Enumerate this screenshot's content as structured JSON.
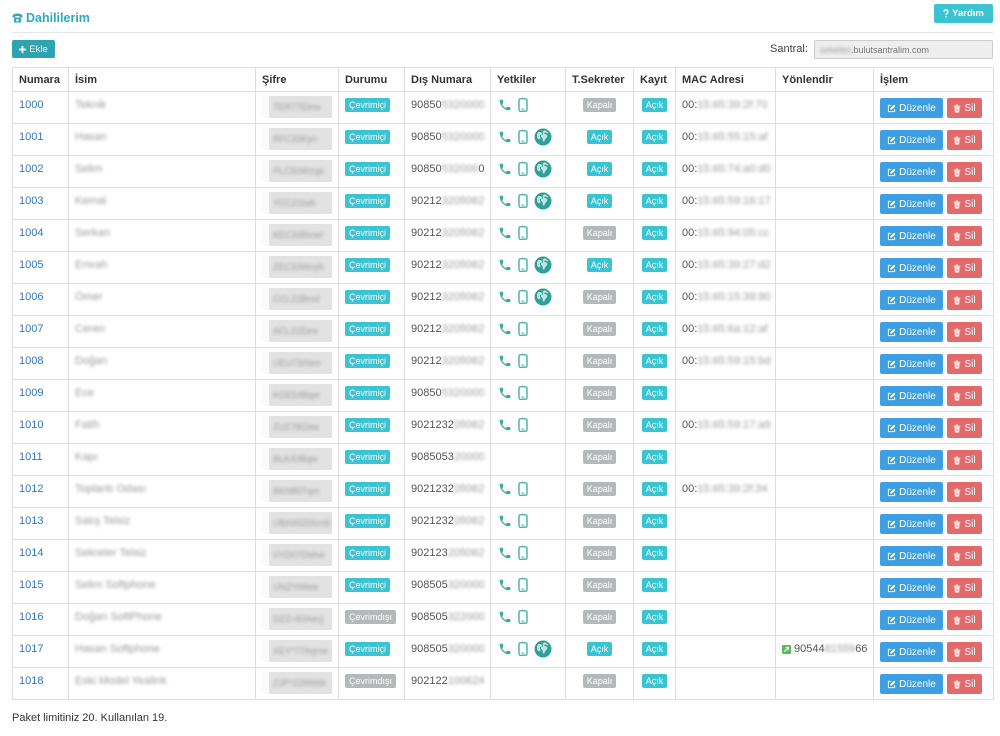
{
  "header": {
    "title": "Dahililerim",
    "help_label": "Yardım"
  },
  "toolbar": {
    "add_label": "Ekle",
    "santral_label": "Santral:",
    "santral_value_masked": "sirketim",
    "santral_value": ".bulutsantralim.com"
  },
  "table": {
    "columns": [
      "Numara",
      "İsim",
      "Şifre",
      "Durumu",
      "Dış Numara",
      "Yetkiler",
      "T.Sekreter",
      "Kayıt",
      "MAC Adresi",
      "Yönlendir",
      "İşlem"
    ],
    "edit_label": "Düzenle",
    "delete_label": "Sil",
    "rows": [
      {
        "number": "1000",
        "name": "Teknik",
        "password": "TER77Elmx",
        "status": "Çevrimiçi",
        "online": true,
        "ext_prefix": "90850",
        "ext_masked": "5320000",
        "perms": [
          "phone-icon",
          "mobile-icon"
        ],
        "secretary": "Kapalı",
        "secretary_on": false,
        "record": "Açık",
        "record_on": true,
        "mac_prefix": "00:",
        "mac_masked": "15:65:39:2f:70"
      },
      {
        "number": "1001",
        "name": "Hasan",
        "password": "RFC33Kyn",
        "status": "Çevrimiçi",
        "online": true,
        "ext_prefix": "90850",
        "ext_masked": "5320000",
        "perms": [
          "phone-icon",
          "mobile-icon",
          "globe-icon"
        ],
        "secretary": "Açık",
        "secretary_on": true,
        "record": "Açık",
        "record_on": true,
        "mac_prefix": "00:",
        "mac_masked": "15:65:55:15:af"
      },
      {
        "number": "1002",
        "name": "Selim",
        "password": "PLC50Wzqa",
        "status": "Çevrimiçi",
        "online": true,
        "ext_prefix": "90850",
        "ext_masked": "532000",
        "ext_suffix": "0",
        "perms": [
          "phone-icon",
          "mobile-icon",
          "globe-icon"
        ],
        "secretary": "Açık",
        "secretary_on": true,
        "record": "Açık",
        "record_on": true,
        "mac_prefix": "00:",
        "mac_masked": "15:65:74:a0:d0"
      },
      {
        "number": "1003",
        "name": "Kemal",
        "password": "YCC21lwb",
        "status": "Çevrimiçi",
        "online": true,
        "ext_prefix": "90212",
        "ext_masked": "3205062",
        "perms": [
          "phone-icon",
          "mobile-icon",
          "globe-icon"
        ],
        "secretary": "Açık",
        "secretary_on": true,
        "record": "Açık",
        "record_on": true,
        "mac_prefix": "00:",
        "mac_masked": "15:65:59:16:17"
      },
      {
        "number": "1004",
        "name": "Serkan",
        "password": "KEC33Rmer",
        "status": "Çevrimiçi",
        "online": true,
        "ext_prefix": "90212",
        "ext_masked": "3205062",
        "perms": [
          "phone-icon",
          "mobile-icon"
        ],
        "secretary": "Kapalı",
        "secretary_on": false,
        "record": "Açık",
        "record_on": true,
        "mac_prefix": "00:",
        "mac_masked": "15:65:94:05:cc"
      },
      {
        "number": "1005",
        "name": "Emrah",
        "password": "ZEC33Wnyh",
        "status": "Çevrimiçi",
        "online": true,
        "ext_prefix": "90212",
        "ext_masked": "3205062",
        "perms": [
          "phone-icon",
          "mobile-icon",
          "globe-icon"
        ],
        "secretary": "Açık",
        "secretary_on": true,
        "record": "Açık",
        "record_on": true,
        "mac_prefix": "00:",
        "mac_masked": "15:65:39:27:d2"
      },
      {
        "number": "1006",
        "name": "Ömer",
        "password": "CCL22Bmd",
        "status": "Çevrimiçi",
        "online": true,
        "ext_prefix": "90212",
        "ext_masked": "3205062",
        "perms": [
          "phone-icon",
          "mobile-icon",
          "globe-icon"
        ],
        "secretary": "Kapalı",
        "secretary_on": false,
        "record": "Açık",
        "record_on": true,
        "mac_prefix": "00:",
        "mac_masked": "15:65:15:39:80"
      },
      {
        "number": "1007",
        "name": "Ceren",
        "password": "ACL22Eew",
        "status": "Çevrimiçi",
        "online": true,
        "ext_prefix": "90212",
        "ext_masked": "3205062",
        "perms": [
          "phone-icon",
          "mobile-icon"
        ],
        "secretary": "Kapalı",
        "secretary_on": false,
        "record": "Açık",
        "record_on": true,
        "mac_prefix": "00:",
        "mac_masked": "15:65:6a:12:af"
      },
      {
        "number": "1008",
        "name": "Doğan",
        "password": "UEU73Xbm",
        "status": "Çevrimiçi",
        "online": true,
        "ext_prefix": "90212",
        "ext_masked": "3205062",
        "perms": [
          "phone-icon",
          "mobile-icon"
        ],
        "secretary": "Kapalı",
        "secretary_on": false,
        "record": "Açık",
        "record_on": true,
        "mac_prefix": "00:",
        "mac_masked": "15:65:59:15:bd"
      },
      {
        "number": "1009",
        "name": "Ece",
        "password": "KGE54Bqw",
        "status": "Çevrimiçi",
        "online": true,
        "ext_prefix": "90850",
        "ext_masked": "5320000",
        "perms": [
          "phone-icon",
          "mobile-icon"
        ],
        "secretary": "Kapalı",
        "secretary_on": false,
        "record": "Açık",
        "record_on": true
      },
      {
        "number": "1010",
        "name": "Fatih",
        "password": "ZUZ78Gbw",
        "status": "Çevrimiçi",
        "online": true,
        "ext_prefix": "9021232",
        "ext_masked": "05062",
        "perms": [
          "phone-icon",
          "mobile-icon"
        ],
        "secretary": "Kapalı",
        "secretary_on": false,
        "record": "Açık",
        "record_on": true,
        "mac_prefix": "00:",
        "mac_masked": "15:65:59:17:a9"
      },
      {
        "number": "1011",
        "name": "Kapı",
        "password": "BLK43Bqw",
        "status": "Çevrimiçi",
        "online": true,
        "ext_prefix": "9085053",
        "ext_masked": "20000",
        "perms": [],
        "secretary": "Kapalı",
        "secretary_on": false,
        "record": "Açık",
        "record_on": true
      },
      {
        "number": "1012",
        "name": "Toplantı Odası",
        "password": "BKN80Tqm",
        "status": "Çevrimiçi",
        "online": true,
        "ext_prefix": "9021232",
        "ext_masked": "05062",
        "perms": [
          "phone-icon",
          "mobile-icon"
        ],
        "secretary": "Kapalı",
        "secretary_on": false,
        "record": "Açık",
        "record_on": true,
        "mac_prefix": "00:",
        "mac_masked": "15:65:39:2f:34"
      },
      {
        "number": "1013",
        "name": "Satış Telsiz",
        "password": "UBA90ZDcmb",
        "status": "Çevrimiçi",
        "online": true,
        "ext_prefix": "9021232",
        "ext_masked": "05062",
        "perms": [
          "phone-icon",
          "mobile-icon"
        ],
        "secretary": "Kapalı",
        "secretary_on": false,
        "record": "Açık",
        "record_on": true
      },
      {
        "number": "1014",
        "name": "Sekreter Telsiz",
        "password": "VYD07Dbhw",
        "status": "Çevrimiçi",
        "online": true,
        "ext_prefix": "902123",
        "ext_masked": "205062",
        "perms": [
          "phone-icon",
          "mobile-icon"
        ],
        "secretary": "Kapalı",
        "secretary_on": false,
        "record": "Açık",
        "record_on": true
      },
      {
        "number": "1015",
        "name": "Selim Softphone",
        "password": "UNZ*0Wee",
        "status": "Çevrimiçi",
        "online": true,
        "ext_prefix": "908505",
        "ext_masked": "320000",
        "perms": [
          "phone-icon",
          "mobile-icon"
        ],
        "secretary": "Kapalı",
        "secretary_on": false,
        "record": "Açık",
        "record_on": true
      },
      {
        "number": "1016",
        "name": "Doğan SoftPhone",
        "password": "DZZ=83Aecj",
        "status": "Çevrimdışı",
        "online": false,
        "ext_prefix": "908505",
        "ext_masked": "322000",
        "perms": [
          "phone-icon",
          "mobile-icon"
        ],
        "secretary": "Kapalı",
        "secretary_on": false,
        "record": "Açık",
        "record_on": true
      },
      {
        "number": "1017",
        "name": "Hasan Softphone",
        "password": "XEY*77Aqme",
        "status": "Çevrimiçi",
        "online": true,
        "ext_prefix": "908505",
        "ext_masked": "320000",
        "perms": [
          "phone-icon",
          "mobile-icon",
          "globe-icon"
        ],
        "secretary": "Açık",
        "secretary_on": true,
        "record": "Açık",
        "record_on": true,
        "forward_prefix": "90544",
        "forward_masked": "81559",
        "forward_suffix": "66"
      },
      {
        "number": "1018",
        "name": "Eski Model Yealink",
        "password": "ZJP*22Wbbb",
        "status": "Çevrimdışı",
        "online": false,
        "ext_prefix": "902122",
        "ext_masked": "100624",
        "perms": [],
        "secretary": "Kapalı",
        "secretary_on": false,
        "record": "Açık",
        "record_on": true
      }
    ]
  },
  "footer": {
    "text": "Paket limitiniz 20. Kullanılan 19."
  },
  "colors": {
    "accent": "#3cc3d2",
    "accent-dark": "#2ea4b3",
    "title": "#2ea9bf",
    "edit": "#3d9fe2",
    "delete": "#e26a6a",
    "off": "#b5b8bb",
    "link": "#2f78b7",
    "icon": "#3aa6a0",
    "forward": "#5cb85c"
  }
}
